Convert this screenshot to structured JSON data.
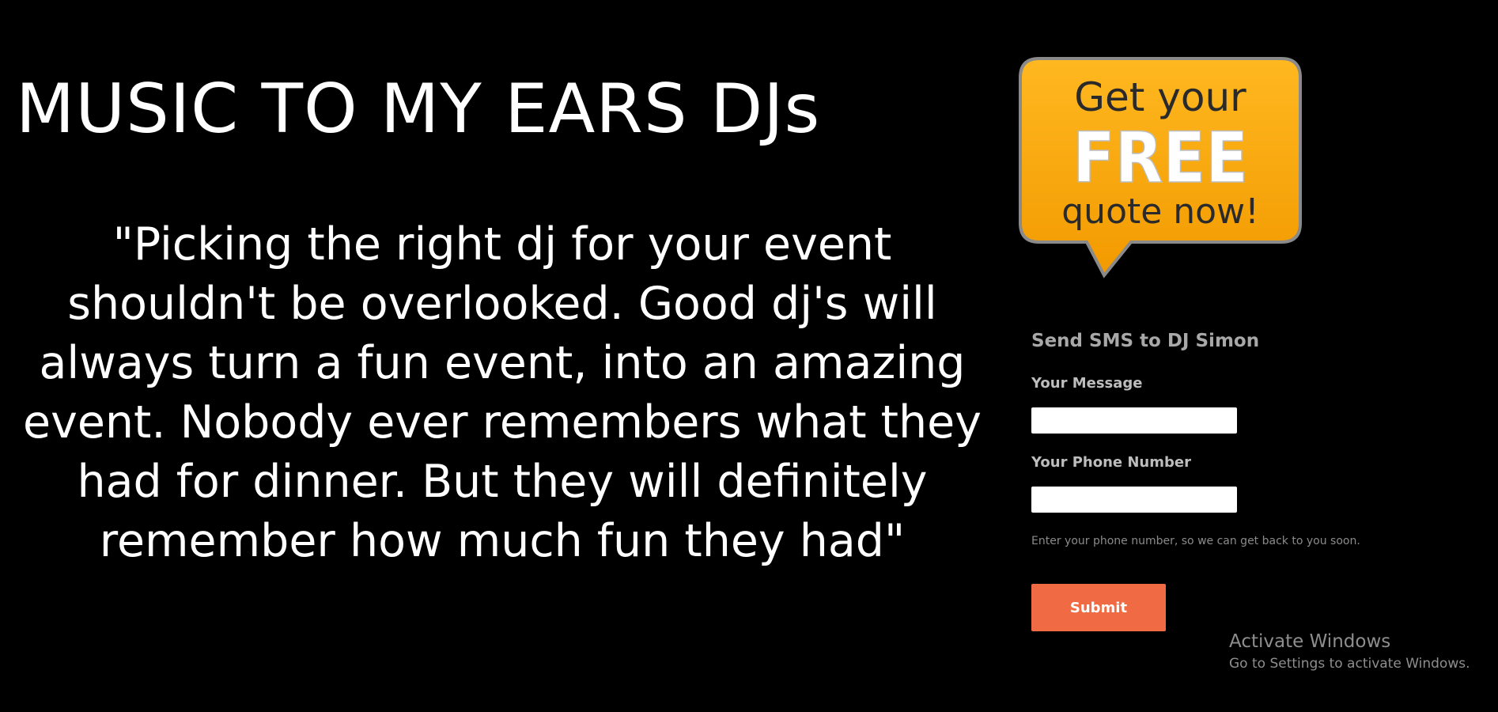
{
  "header": {
    "title": "MUSIC TO MY EARS DJs"
  },
  "testimonial": {
    "quote": "\"Picking the right dj for your event shouldn't be overlooked. Good dj's will always turn a fun event, into an amazing event. Nobody ever remembers what they had for dinner. But they will definitely remember how much fun they had\""
  },
  "promo": {
    "line1": "Get your",
    "line2": "FREE",
    "line3": "quote now!",
    "colors": {
      "bubble": "#f5a300",
      "bubble_border": "#8a8a8a",
      "text_dark": "#2a2a2a",
      "text_light": "#ffffff"
    }
  },
  "sms_form": {
    "heading": "Send SMS to DJ Simon",
    "message_label": "Your Message",
    "message_value": "",
    "phone_label": "Your Phone Number",
    "phone_value": "",
    "phone_hint": "Enter your phone number, so we can get back to you soon.",
    "submit_label": "Submit",
    "submit_color": "#f06b43"
  },
  "os_watermark": {
    "title": "Activate Windows",
    "subtitle": "Go to Settings to activate Windows."
  }
}
